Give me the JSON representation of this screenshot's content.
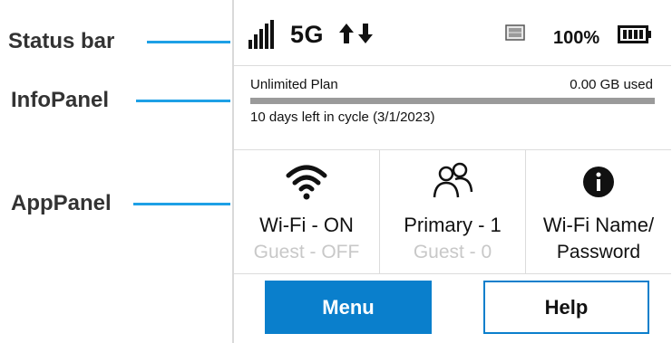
{
  "callouts": {
    "status_bar": "Status bar",
    "info_panel": "InfoPanel",
    "app_panel": "AppPanel"
  },
  "status_bar": {
    "network_type": "5G",
    "signal_icon": "signal-bars-icon",
    "data_arrows_icon": "up-down-arrows-icon",
    "sim_icon": "sim-card-icon",
    "battery_percent": "100%",
    "battery_icon": "battery-full-icon"
  },
  "info_panel": {
    "plan_name": "Unlimited Plan",
    "usage": "0.00 GB used",
    "usage_fraction": 0,
    "cycle_text": "10 days left in cycle (3/1/2023)"
  },
  "app_panel": {
    "tiles": [
      {
        "icon": "wifi-icon",
        "line1": "Wi-Fi - ON",
        "line2": "Guest - OFF"
      },
      {
        "icon": "users-icon",
        "line1": "Primary - 1",
        "line2": "Guest - 0"
      },
      {
        "icon": "info-icon",
        "line1": "Wi-Fi Name/",
        "line2": "Password"
      }
    ]
  },
  "buttons": {
    "menu": "Menu",
    "help": "Help"
  },
  "colors": {
    "accent": "#0a7fcc",
    "callout_line": "#1ea0e6",
    "muted_text": "#c8c8c8"
  }
}
